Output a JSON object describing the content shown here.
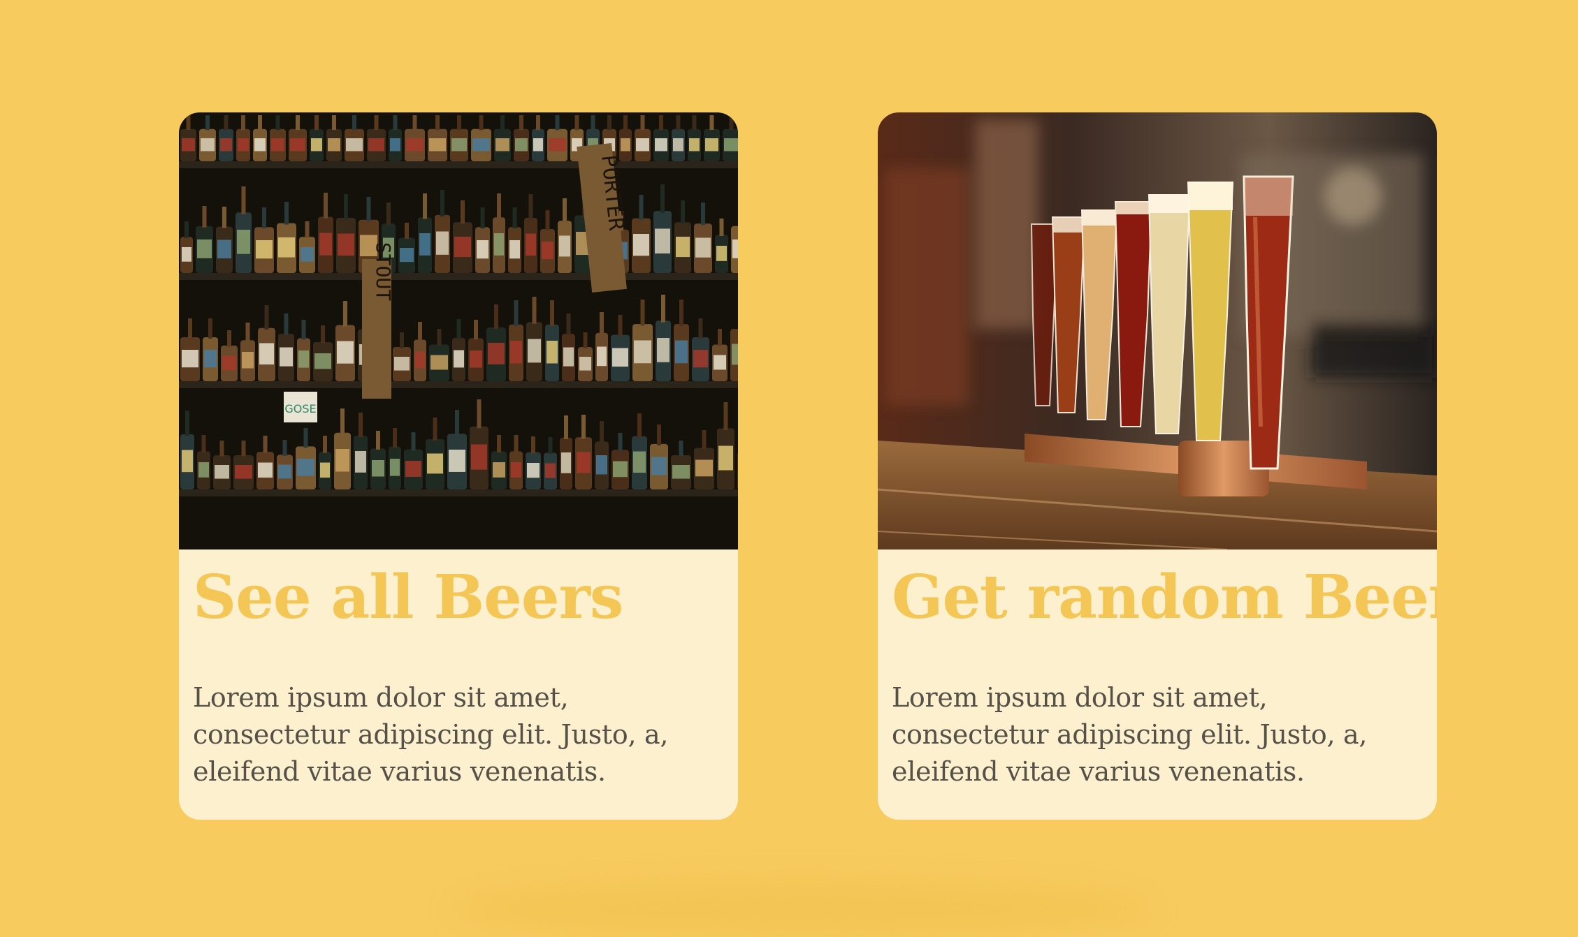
{
  "cards": [
    {
      "title": "See all Beers",
      "text": "Lorem ipsum dolor sit amet, consectetur adipiscing elit. Justo, a, eleifend vitae varius venenatis.",
      "image": "beer-bottle-shelves-photo"
    },
    {
      "title": "Get random Beer",
      "text": "Lorem ipsum dolor sit amet, consectetur adipiscing elit. Justo, a, eleifend vitae varius venenatis.",
      "image": "beer-tasting-flight-photo"
    }
  ],
  "shelf_signs": [
    "STOUT",
    "PORTER",
    "GOSE"
  ],
  "colors": {
    "background": "#f7cb5e",
    "card": "#fdf0cf",
    "title": "#f4c656",
    "text": "#555149"
  }
}
